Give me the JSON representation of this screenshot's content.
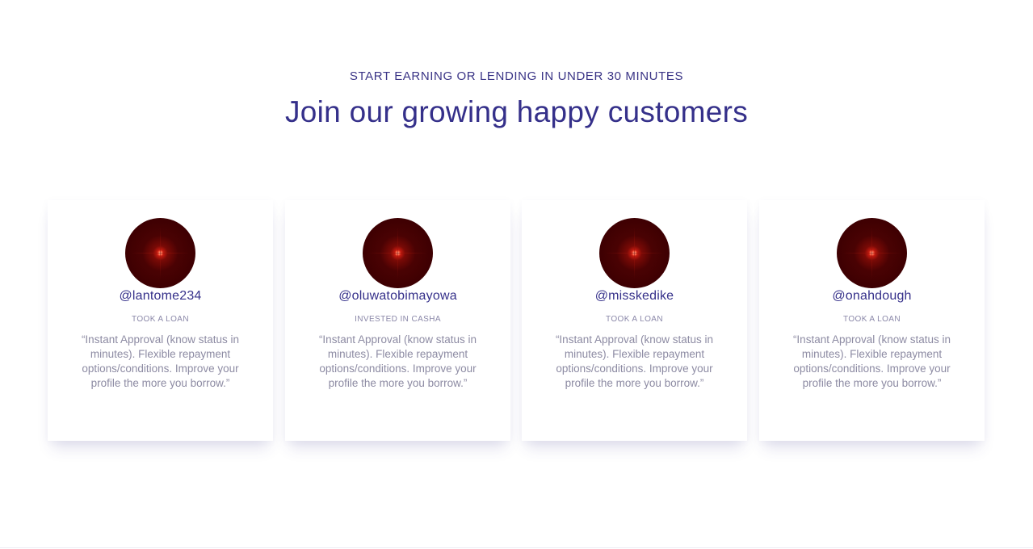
{
  "section": {
    "eyebrow": "START EARNING OR LENDING IN UNDER 30 MINUTES",
    "headline": "Join our growing happy customers"
  },
  "testimonials": [
    {
      "handle": "@lantome234",
      "role": "TOOK A LOAN",
      "quote": "“Instant Approval (know status in minutes). Flexible repayment options/conditions. Improve your profile the more you borrow.”"
    },
    {
      "handle": "@oluwatobimayowa",
      "role": "INVESTED IN CASHA",
      "quote": "“Instant Approval (know status in minutes). Flexible repayment options/conditions. Improve your profile the more you borrow.”"
    },
    {
      "handle": "@misskedike",
      "role": "TOOK A LOAN",
      "quote": "“Instant Approval (know status in minutes). Flexible repayment options/conditions. Improve your profile the more you borrow.”"
    },
    {
      "handle": "@onahdough",
      "role": "TOOK A LOAN",
      "quote": "“Instant Approval (know status in minutes). Flexible repayment options/conditions. Improve your profile the more you borrow.”"
    }
  ],
  "colors": {
    "heading": "#35308a",
    "muted_text": "#8d8ba3",
    "avatar_bg": "#3d0002",
    "card_bg": "#ffffff"
  }
}
